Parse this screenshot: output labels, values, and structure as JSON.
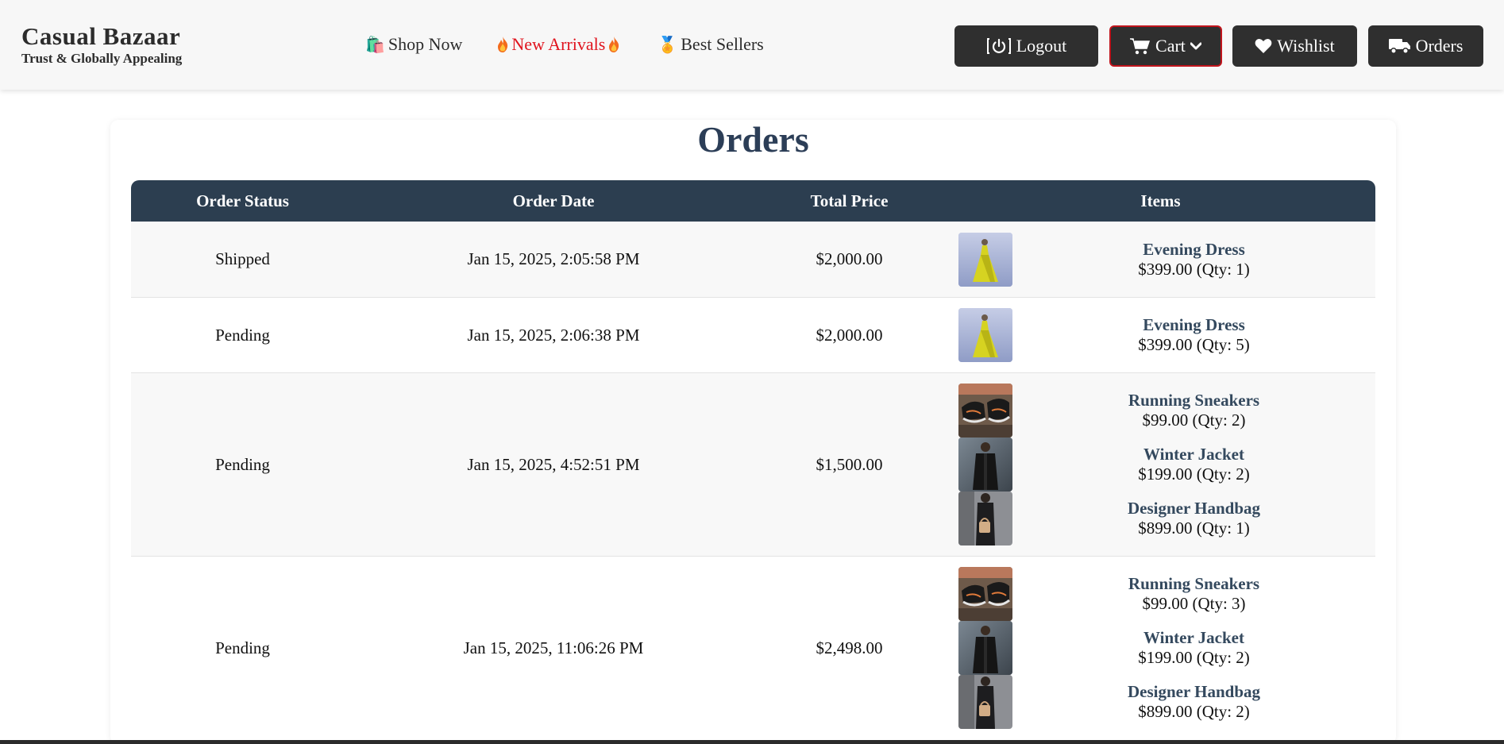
{
  "brand": {
    "title": "Casual Bazaar",
    "subtitle": "Trust & Globally Appealing"
  },
  "nav": {
    "shop_emoji": "🛍️",
    "shop_label": "Shop Now",
    "arrivals_label": "New Arrivals",
    "best_emoji": "🏅",
    "best_label": "Best Sellers"
  },
  "buttons": {
    "logout": "Logout",
    "cart": "Cart",
    "wishlist": "Wishlist",
    "orders": "Orders"
  },
  "colors": {
    "header_bg": "#f7f7f7",
    "button_bg": "#2f2f2f",
    "table_header_bg": "#2c3e50",
    "accent_red": "#e0141e",
    "item_name": "#34495e"
  },
  "page": {
    "title": "Orders"
  },
  "table": {
    "headers": [
      "Order Status",
      "Order Date",
      "Total Price",
      "Items"
    ],
    "rows": [
      {
        "status": "Shipped",
        "date": "Jan 15, 2025, 2:05:58 PM",
        "total": "$2,000.00",
        "items": [
          {
            "name": "Evening Dress",
            "price": "$399.00 (Qty: 1)",
            "thumb": "yellow-dress"
          }
        ]
      },
      {
        "status": "Pending",
        "date": "Jan 15, 2025, 2:06:38 PM",
        "total": "$2,000.00",
        "items": [
          {
            "name": "Evening Dress",
            "price": "$399.00 (Qty: 5)",
            "thumb": "yellow-dress"
          }
        ]
      },
      {
        "status": "Pending",
        "date": "Jan 15, 2025, 4:52:51 PM",
        "total": "$1,500.00",
        "items": [
          {
            "name": "Running Sneakers",
            "price": "$99.00 (Qty: 2)",
            "thumb": "sneakers"
          },
          {
            "name": "Winter Jacket",
            "price": "$199.00 (Qty: 2)",
            "thumb": "jacket"
          },
          {
            "name": "Designer Handbag",
            "price": "$899.00 (Qty: 1)",
            "thumb": "handbag"
          }
        ]
      },
      {
        "status": "Pending",
        "date": "Jan 15, 2025, 11:06:26 PM",
        "total": "$2,498.00",
        "items": [
          {
            "name": "Running Sneakers",
            "price": "$99.00 (Qty: 3)",
            "thumb": "sneakers"
          },
          {
            "name": "Winter Jacket",
            "price": "$199.00 (Qty: 2)",
            "thumb": "jacket"
          },
          {
            "name": "Designer Handbag",
            "price": "$899.00 (Qty: 2)",
            "thumb": "handbag"
          }
        ]
      }
    ]
  }
}
